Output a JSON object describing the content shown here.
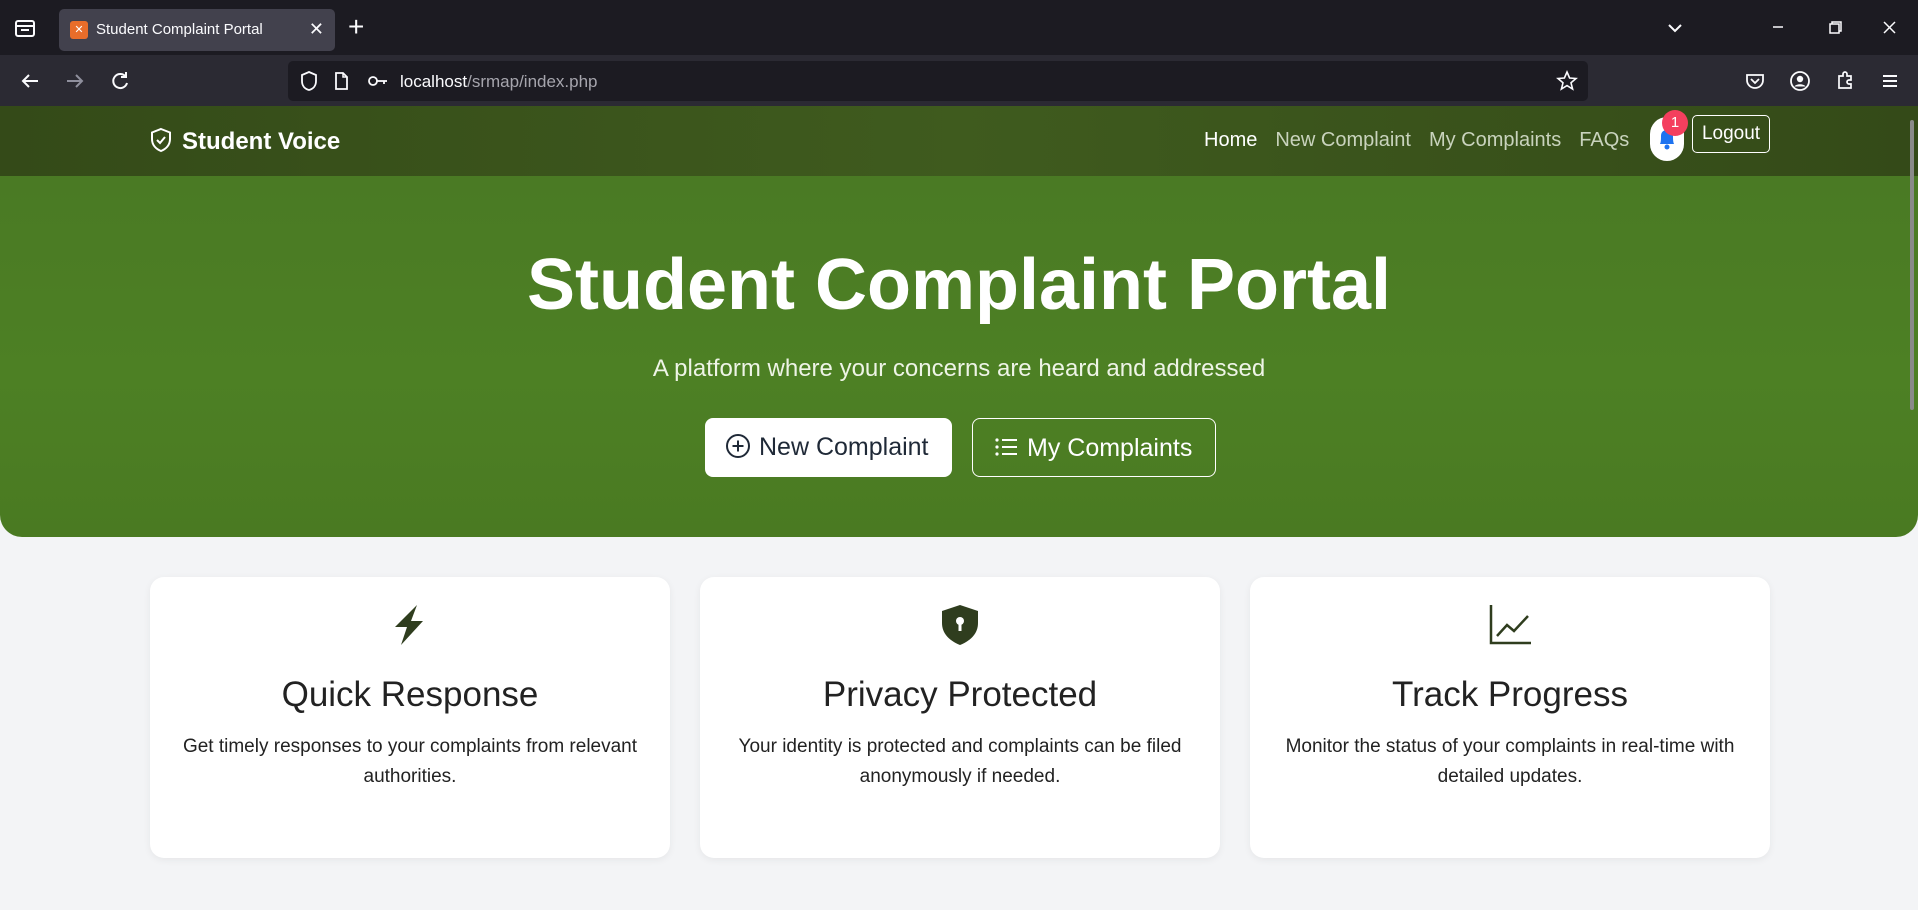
{
  "browser": {
    "tab_title": "Student Complaint Portal",
    "tab_favicon": "xampp-favicon",
    "url_host": "localhost",
    "url_path": "/srmap/index.php"
  },
  "site": {
    "brand": "Student Voice",
    "nav": {
      "home": "Home",
      "new_complaint": "New Complaint",
      "my_complaints": "My Complaints",
      "faqs": "FAQs",
      "notification_count": "1",
      "logout": "Logout"
    },
    "hero": {
      "title": "Student Complaint Portal",
      "subtitle": "A platform where your concerns are heard and addressed",
      "new_complaint_button": "New Complaint",
      "my_complaints_button": "My Complaints"
    },
    "features": [
      {
        "icon": "lightning-icon",
        "title": "Quick Response",
        "text": "Get timely responses to your complaints from relevant authorities."
      },
      {
        "icon": "shield-lock-icon",
        "title": "Privacy Protected",
        "text": "Your identity is protected and complaints can be filed anonymously if needed."
      },
      {
        "icon": "graph-up-icon",
        "title": "Track Progress",
        "text": "Monitor the status of your complaints in real-time with detailed updates."
      }
    ]
  },
  "colors": {
    "nav_bg": "#3a5219",
    "hero_bg": "#4d7e24",
    "icon_color": "#2f3d1e",
    "badge": "#f43f5e",
    "bell": "#1e73f0"
  }
}
